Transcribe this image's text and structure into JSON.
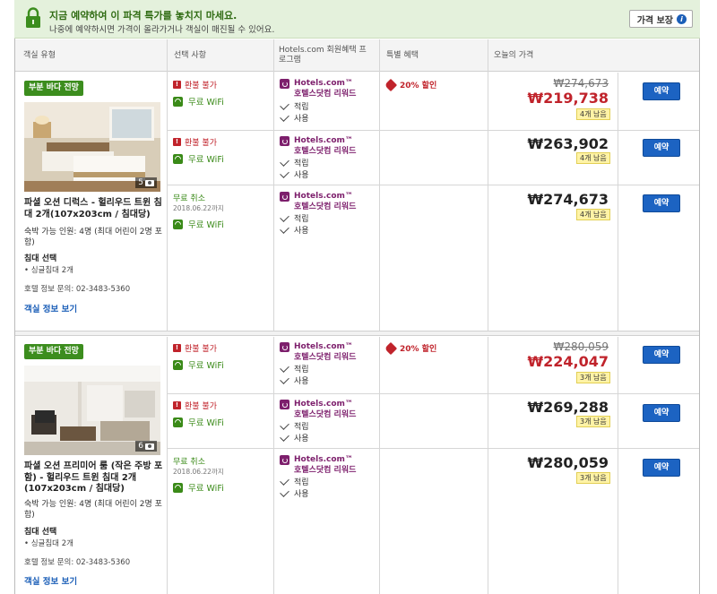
{
  "banner": {
    "title": "지금 예약하여 이 파격 특가를 놓치지 마세요.",
    "subtitle": "나중에 예약하시면 가격이 올라가거나 객실이 매진될 수 있어요.",
    "guarantee_label": "가격 보장",
    "colors": {
      "background": "#e4f1dc",
      "title": "#2f6b12"
    }
  },
  "table": {
    "headers": {
      "room_type": "객실 유형",
      "options": "선택 사항",
      "rewards": "Hotels.com 회원혜택 프로그램",
      "special": "특별 혜택",
      "price": "오늘의 가격"
    }
  },
  "labels": {
    "non_refundable": "환불 불가",
    "free_cancel": "무료 취소",
    "wifi": "무료 WiFi",
    "hc_brand": "Hotels.com™",
    "hc_program": "호텔스닷컴 리워드",
    "earn": "적립",
    "redeem": "사용",
    "discount": "20% 할인",
    "book": "예약",
    "bed_select": "침대 선택",
    "room_info_link": "객실 정보 보기"
  },
  "rooms": [
    {
      "badge": "부분 바다 전망",
      "photo_count": "5",
      "name": "파셜 오션 디럭스 - 헐리우드 트윈 침대 2개(107x203cm / 침대당)",
      "occupancy": "숙박 가능 인원: 4명 (최대 어린이 2명 포함)",
      "bed": "• 싱글침대 2개",
      "contact": "호텔 정보 문의: 02-3483-5360",
      "rates": [
        {
          "refund": "환불 불가",
          "old_price": "₩274,673",
          "price": "₩219,738",
          "left": "4개 남음",
          "discount": true
        },
        {
          "refund": "환불 불가",
          "old_price": "",
          "price": "₩263,902",
          "left": "4개 남음",
          "discount": false
        },
        {
          "refund": "무료 취소",
          "refund_date": "2018.06.22까지",
          "old_price": "",
          "price": "₩274,673",
          "left": "4개 남음",
          "discount": false
        }
      ]
    },
    {
      "badge": "부분 바다 전망",
      "photo_count": "6",
      "name": "파셜 오션 프리미어 룸 (작은 주방 포함) - 헐리우드 트윈 침대 2개(107x203cm / 침대당)",
      "occupancy": "숙박 가능 인원: 4명 (최대 어린이 2명 포함)",
      "bed": "• 싱글침대 2개",
      "contact": "호텔 정보 문의: 02-3483-5360",
      "rates": [
        {
          "refund": "환불 불가",
          "old_price": "₩280,059",
          "price": "₩224,047",
          "left": "3개 남음",
          "discount": true
        },
        {
          "refund": "환불 불가",
          "old_price": "",
          "price": "₩269,288",
          "left": "3개 남음",
          "discount": false
        },
        {
          "refund": "무료 취소",
          "refund_date": "2018.06.22까지",
          "old_price": "",
          "price": "₩280,059",
          "left": "3개 남음",
          "discount": false
        }
      ]
    }
  ]
}
